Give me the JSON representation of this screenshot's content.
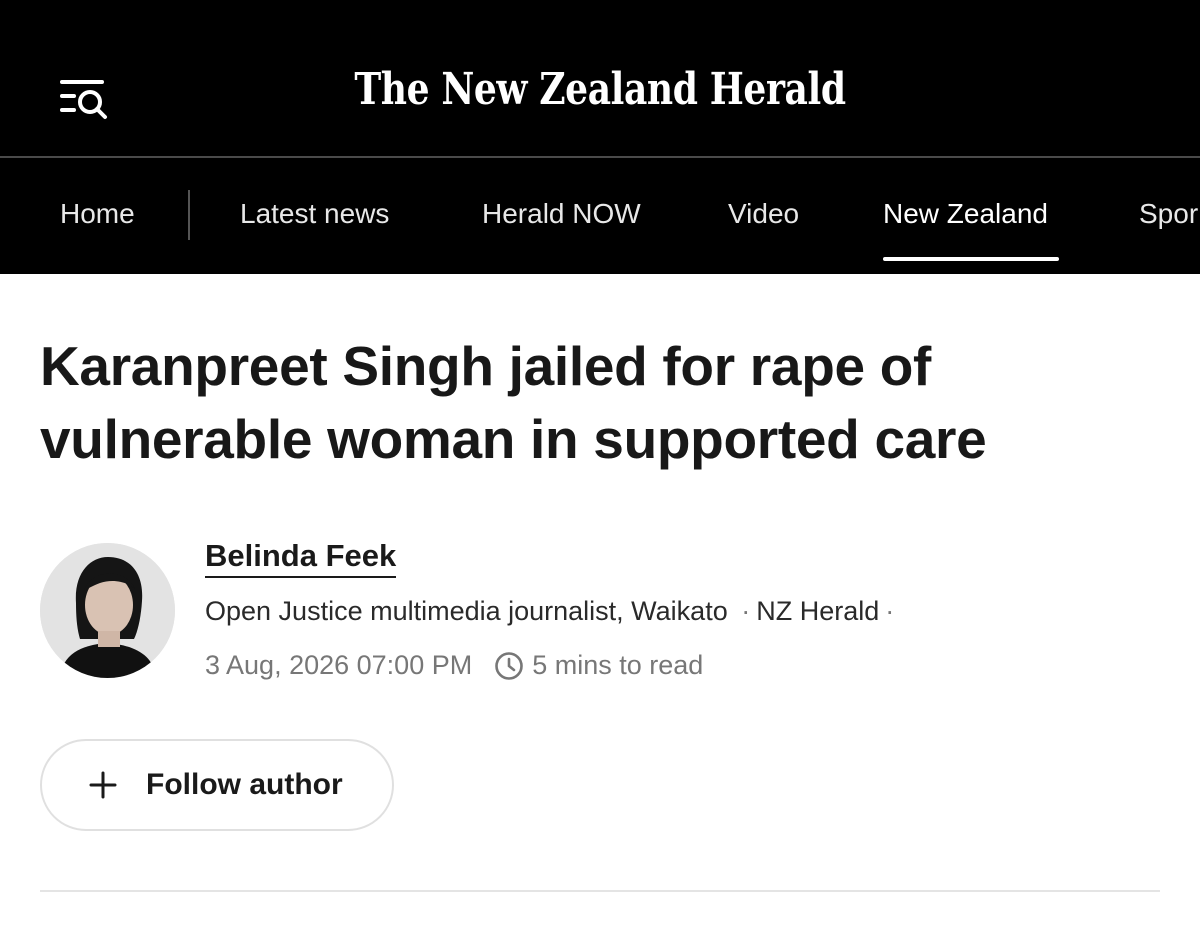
{
  "header": {
    "masthead": "The New Zealand Herald",
    "menu_icon": "menu-search-icon",
    "background": "#000000"
  },
  "nav": {
    "items": [
      {
        "label": "Home"
      },
      {
        "label": "Latest news"
      },
      {
        "label": "Herald NOW"
      },
      {
        "label": "Video"
      },
      {
        "label": "New Zealand",
        "active": true
      },
      {
        "label": "Spor"
      }
    ]
  },
  "article": {
    "headline_line1": "Karanpreet Singh jailed for rape of",
    "headline_line2": "vulnerable woman in supported care",
    "author": {
      "name": "Belinda Feek",
      "role": "Open Justice multimedia journalist, Waikato",
      "outlet": "NZ Herald",
      "separator": "·",
      "date": "3 Aug, 2026 07:00 PM",
      "read_time": "5 mins to read"
    },
    "follow_button": {
      "label": "Follow author",
      "icon": "plus-icon"
    }
  },
  "colors": {
    "nav_bg": "#000000",
    "nav_text": "#e8e8e8",
    "headline": "#181818",
    "meta_gray": "#777777"
  }
}
